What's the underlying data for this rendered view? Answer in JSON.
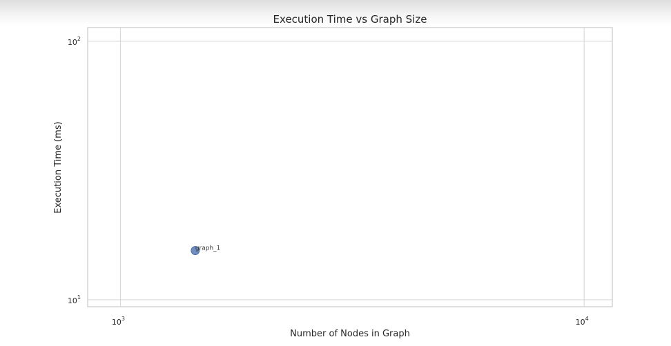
{
  "chart_data": {
    "type": "scatter",
    "title": "Execution Time vs Graph Size",
    "xlabel": "Number of Nodes in Graph",
    "ylabel": "Execution Time (ms)",
    "xscale": "log",
    "yscale": "log",
    "xlim": [
      850,
      11500
    ],
    "ylim": [
      9.4,
      113
    ],
    "xticks": [
      {
        "value": 1000,
        "base": "10",
        "exp": "3"
      },
      {
        "value": 10000,
        "base": "10",
        "exp": "4"
      }
    ],
    "yticks": [
      {
        "value": 10,
        "base": "10",
        "exp": "1"
      },
      {
        "value": 100,
        "base": "10",
        "exp": "2"
      }
    ],
    "grid": true,
    "points": [
      {
        "x": 1450,
        "y": 15.5,
        "label": "graph_1"
      }
    ],
    "colors": {
      "point": "#4c72b0",
      "grid": "#d4d4d4",
      "spine": "#c8c8c8"
    }
  }
}
